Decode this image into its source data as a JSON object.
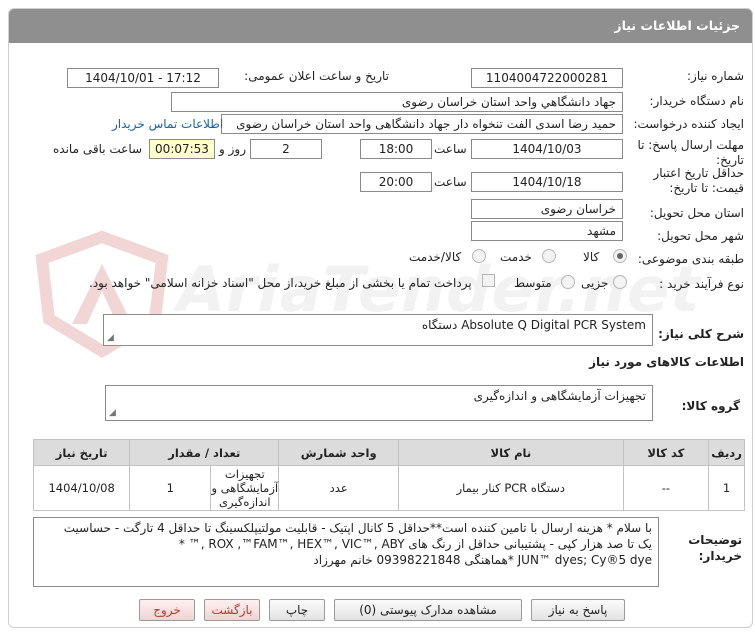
{
  "header": {
    "title": "جزئیات اطلاعات نیاز"
  },
  "fields": {
    "need_number_label": "شماره نیاز:",
    "need_number": "1104004722000281",
    "announce_label": "تاریخ و ساعت اعلان عمومی:",
    "announce_value": "1404/10/01 - 17:12",
    "buyer_label": "نام دستگاه خریدار:",
    "buyer_value": "جهاد دانشگاهي واحد استان خراسان رضوی",
    "requester_label": "ایجاد کننده درخواست:",
    "requester_value": "حمید رضا اسدی الفت تنخواه دار جهاد دانشگاهی واحد استان خراسان رضوی",
    "contact_link": "اطلاعات تماس خریدار",
    "deadline_label_1": "مهلت ارسال پاسخ: تا",
    "deadline_label_2": "تاریخ:",
    "deadline_date": "1404/10/03",
    "time_label": "ساعت",
    "deadline_time": "18:00",
    "days_value": "2",
    "days_label": "روز و",
    "remaining_value": "00:07:53",
    "remaining_label": "ساعت باقی مانده",
    "validity_label_1": "حداقل تاریخ اعتبار",
    "validity_label_2": "قیمت: تا تاریخ:",
    "validity_date": "1404/10/18",
    "validity_time": "20:00",
    "province_label": "استان محل تحویل:",
    "province_value": "خراسان رضوی",
    "city_label": "شهر محل تحویل:",
    "city_value": "مشهد",
    "category_label": "طبقه بندی موضوعی:",
    "category_options": [
      "کالا",
      "خدمت",
      "کالا/خدمت"
    ],
    "process_label": "نوع فرآیند خرید :",
    "process_options": [
      "جزیی",
      "متوسط"
    ],
    "payment_note": "پرداخت تمام یا بخشی از مبلغ خرید،از محل \"اسناد خزانه اسلامی\" خواهد بود."
  },
  "summary": {
    "label": "شرح کلی نیاز:",
    "value": "Absolute Q Digital PCR System دستگاه"
  },
  "goods": {
    "section_title": "اطلاعات کالاهای مورد نیاز",
    "group_label": "گروه کالا:",
    "group_value": "تجهیزات آزمایشگاهی و اندازه‌گیری"
  },
  "table": {
    "headers": [
      "ردیف",
      "کد کالا",
      "نام کالا",
      "واحد شمارش",
      "تعداد / مقدار",
      "تاریخ نیاز"
    ],
    "rows": [
      {
        "row": "1",
        "code": "--",
        "name": "دستگاه PCR کنار بیمار",
        "unit": "عدد",
        "qty": "1",
        "date": "1404/10/08",
        "group_line1": "تجهیزات",
        "group_line2": "آزمایشگاهی و",
        "group_line3": "اندازه‌گیری"
      }
    ]
  },
  "buyer_notes": {
    "label_1": "توضیحات",
    "label_2": "خریدار:",
    "line1": "با سلام * هزینه ارسال با تامین کننده است**حداقل 5 کانال اپتیک - قابلیت مولتیپلکسینگ تا  حداقل 4 تارگت - حساسیت",
    "line2": "یک تا صد هزار کپی - پشتیبانی حداقل از رنگ های ROX ,™FAM™, HEX™, VIC™, ABY ,™ *",
    "line3": "JUN™ dyes; Cy®5 dye *هماهنگی  09398221848 خانم مهرزاد"
  },
  "buttons": {
    "reply": "پاسخ به نیاز",
    "attachments": "مشاهده مدارک پیوستی (0)",
    "print": "چاپ",
    "back": "بازگشت",
    "exit": "خروج"
  },
  "watermark": {
    "text": "AriaTender.net"
  },
  "colors": {
    "header_bg": "#8f8f8f",
    "link": "#1a5fb4",
    "timer_bg": "#ffffcc",
    "exit_text": "#c0392b"
  }
}
